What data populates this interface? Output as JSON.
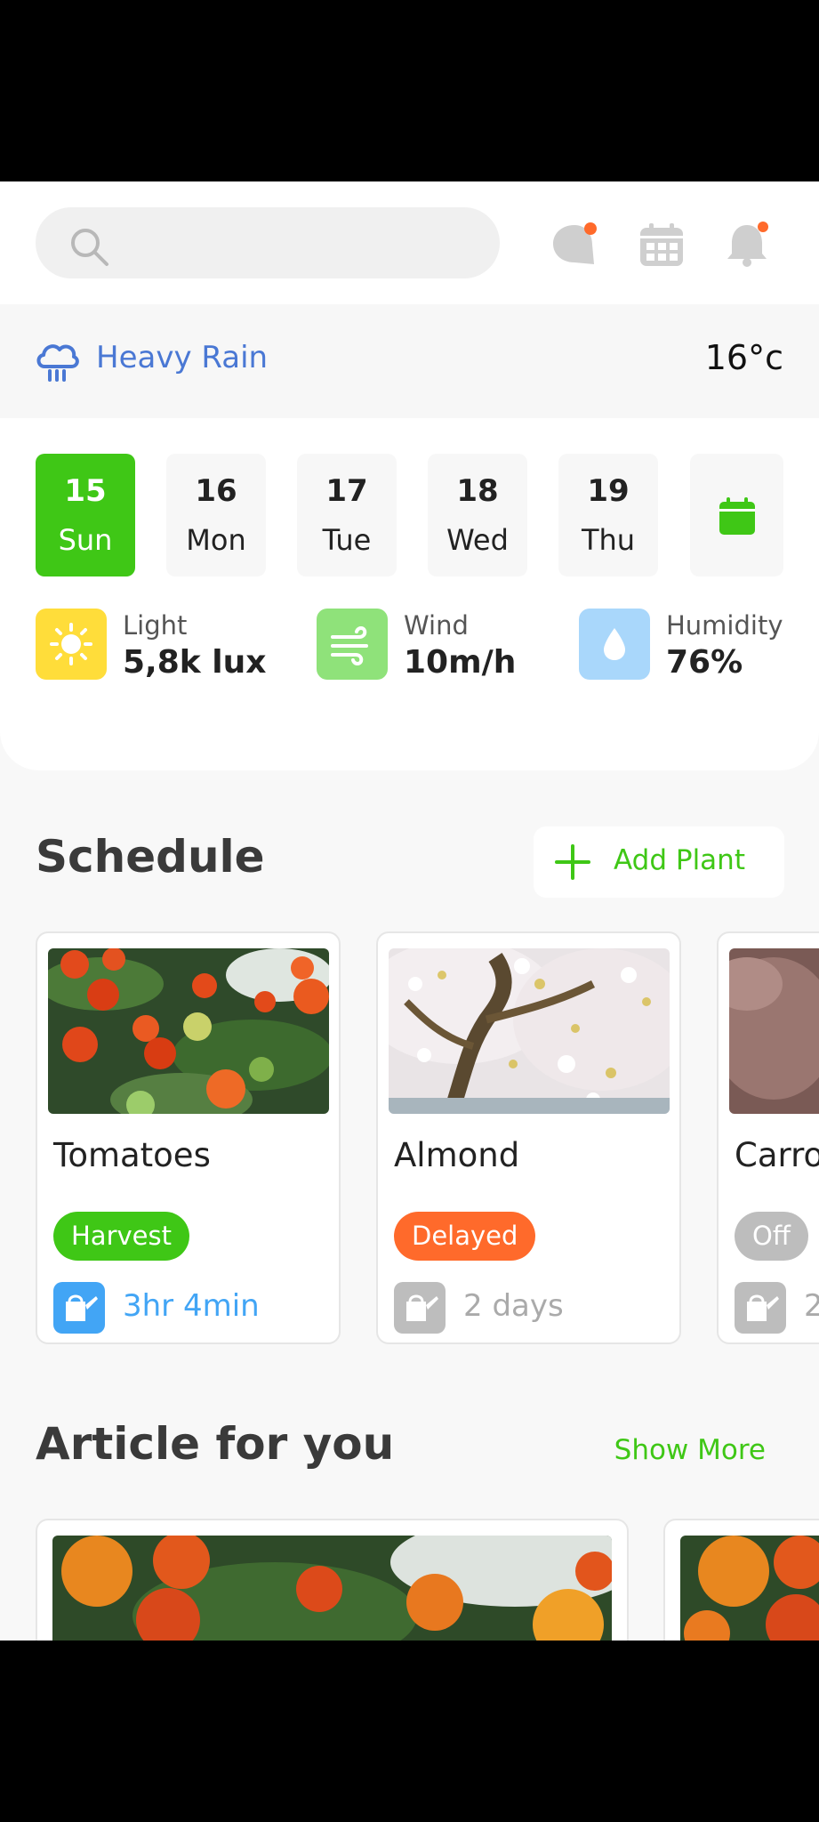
{
  "header": {
    "search_placeholder": "",
    "icons": [
      "search-icon",
      "chat-icon",
      "calendar-icon",
      "bell-icon"
    ]
  },
  "weather": {
    "condition": "Heavy Rain",
    "temperature": "16°c",
    "icon": "rain-cloud-icon"
  },
  "days": [
    {
      "num": "15",
      "name": "Sun",
      "active": true
    },
    {
      "num": "16",
      "name": "Mon",
      "active": false
    },
    {
      "num": "17",
      "name": "Tue",
      "active": false
    },
    {
      "num": "18",
      "name": "Wed",
      "active": false
    },
    {
      "num": "19",
      "name": "Thu",
      "active": false
    }
  ],
  "stats": {
    "light": {
      "label": "Light",
      "value": "5,8k lux",
      "icon": "sun-icon"
    },
    "wind": {
      "label": "Wind",
      "value": "10m/h",
      "icon": "wind-icon"
    },
    "humidity": {
      "label": "Humidity",
      "value": "76%",
      "icon": "water-drop-icon"
    }
  },
  "schedule": {
    "title": "Schedule",
    "add_label": "Add Plant",
    "plants": [
      {
        "name": "Tomatoes",
        "status": "Harvest",
        "status_color": "#3fc716",
        "time": "3hr 4min",
        "time_color": "#42a5f5"
      },
      {
        "name": "Almond",
        "status": "Delayed",
        "status_color": "#ff6a2b",
        "time": "2 days",
        "time_color": "#aaaaaa"
      },
      {
        "name": "Carro",
        "status": "Off",
        "status_color": "#bdbdbd",
        "time": "2",
        "time_color": "#aaaaaa"
      }
    ]
  },
  "articles": {
    "title": "Article for you",
    "show_more": "Show More"
  },
  "colors": {
    "accent": "#3fc716",
    "rain_blue": "#4a78d4",
    "notification_dot": "#ff6a2b"
  }
}
